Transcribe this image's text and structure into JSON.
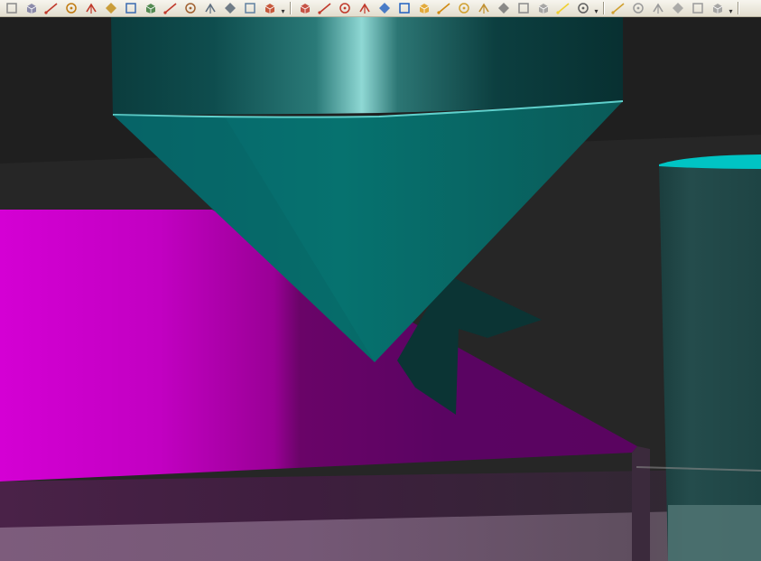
{
  "toolbar": {
    "groups": [
      {
        "name": "edit-tools",
        "items": [
          {
            "icon": "pointer-icon",
            "color": "#8a8a8a"
          },
          {
            "icon": "rotate-view-icon",
            "color": "#7a7aa0"
          },
          {
            "icon": "monitor-edit-icon",
            "color": "#c0392b"
          },
          {
            "icon": "paint-brush-icon",
            "color": "#c07a10"
          },
          {
            "icon": "rectangle-icon",
            "color": "#c0392b"
          },
          {
            "icon": "move-gizmo-icon",
            "color": "#c08a10"
          },
          {
            "icon": "pencil-edit-icon",
            "color": "#3a6ab0"
          },
          {
            "icon": "layers-icon",
            "color": "#3a7a3a"
          },
          {
            "icon": "scatter-tool-icon",
            "color": "#c0392b"
          },
          {
            "icon": "magic-wand-icon",
            "color": "#a06030"
          },
          {
            "icon": "gauge-icon",
            "color": "#607080"
          },
          {
            "icon": "network-icon",
            "color": "#506070"
          },
          {
            "icon": "zoom-box-icon",
            "color": "#6080a0"
          },
          {
            "icon": "fire-icon",
            "color": "#c04020"
          }
        ]
      },
      {
        "name": "view-tools",
        "items": [
          {
            "icon": "view-iso-icon",
            "color": "#c0392b"
          },
          {
            "icon": "view-front-icon",
            "color": "#c0392b"
          },
          {
            "icon": "view-top-icon",
            "color": "#c0392b"
          },
          {
            "icon": "view-axis-icon",
            "color": "#c0392b"
          },
          {
            "icon": "axes-xyz-icon",
            "color": "#2060c0"
          },
          {
            "icon": "axes-origin-icon",
            "color": "#2060c0"
          },
          {
            "icon": "cube-yellow-icon",
            "color": "#e0a020"
          },
          {
            "icon": "cube-orange-icon",
            "color": "#d08a10"
          },
          {
            "icon": "cube-side-icon",
            "color": "#d0a030"
          },
          {
            "icon": "cube-back-icon",
            "color": "#c09030"
          },
          {
            "icon": "cube-wire-icon",
            "color": "#707070"
          },
          {
            "icon": "cube-outline-icon",
            "color": "#8a8a8a"
          },
          {
            "icon": "arrow-down-icon",
            "color": "#9a9a9a"
          },
          {
            "icon": "note-yellow-icon",
            "color": "#f0d030"
          },
          {
            "icon": "magnet-icon",
            "color": "#606060"
          }
        ]
      },
      {
        "name": "snap-tools",
        "items": [
          {
            "icon": "hand-pointer-icon",
            "color": "#d0a030"
          },
          {
            "icon": "line-snap-icon",
            "color": "#9a9a9a"
          },
          {
            "icon": "midpoint-snap-icon",
            "color": "#9a9a9a"
          },
          {
            "icon": "circle-snap-icon",
            "color": "#9a9a9a"
          },
          {
            "icon": "tangent-snap-icon",
            "color": "#9a9a9a"
          },
          {
            "icon": "curve-snap-icon",
            "color": "#9a9a9a"
          }
        ]
      }
    ]
  },
  "scene": {
    "background": "#262626",
    "colors": {
      "cone_teal": "#05706e",
      "cylinder_teal": "#0b4f4f",
      "highlight_cyan": "#6fd6d2",
      "magenta": "#d000d0",
      "magenta_dark": "#5a0460",
      "shadow_teal": "#0b3434",
      "right_cylinder": "#214848",
      "rim_cyan": "#00c8c8",
      "floor_mauve": "#7a5a78"
    }
  }
}
